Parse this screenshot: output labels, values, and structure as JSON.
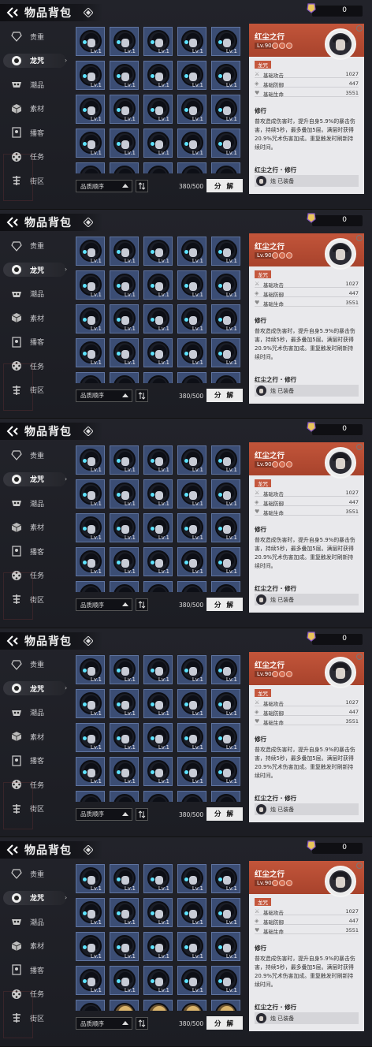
{
  "header": {
    "title": "物品背包"
  },
  "currency": {
    "value": "0"
  },
  "sidebar": {
    "items": [
      {
        "label": "贵重",
        "icon": "gem-icon"
      },
      {
        "label": "龙咒",
        "icon": "ring-icon",
        "active": true
      },
      {
        "label": "潮品",
        "icon": "mask-icon"
      },
      {
        "label": "素材",
        "icon": "cube-icon"
      },
      {
        "label": "播客",
        "icon": "podcast-icon"
      },
      {
        "label": "任务",
        "icon": "film-reel-icon"
      },
      {
        "label": "街区",
        "icon": "district-icon"
      }
    ]
  },
  "grid": {
    "level_label": "Lv.1"
  },
  "controls": {
    "sort_label": "品质顺序",
    "capacity": "380/500",
    "decompose_label": "分 解"
  },
  "detail": {
    "name": "红尘之行",
    "level": "Lv.90",
    "tag": "龙咒",
    "stats": [
      {
        "label": "基础攻击",
        "value": "1027"
      },
      {
        "label": "基础防御",
        "value": "447"
      },
      {
        "label": "基础生命",
        "value": "3551"
      }
    ],
    "skill_title": "修行",
    "skill_text": "普攻造成伤害时，提升自身5.9%的暴击伤害，持续5秒，最多叠加5层。满层时获得20.9%咒术伤害加成。重复触发时刷新持续时间。",
    "set_title": "红尘之行 · 修行",
    "equipped_text": "烛 已装备"
  },
  "colors": {
    "accent": "#c2553a",
    "cell_bg": "#3b4d74",
    "detail_bg": "#e9e9ec"
  }
}
